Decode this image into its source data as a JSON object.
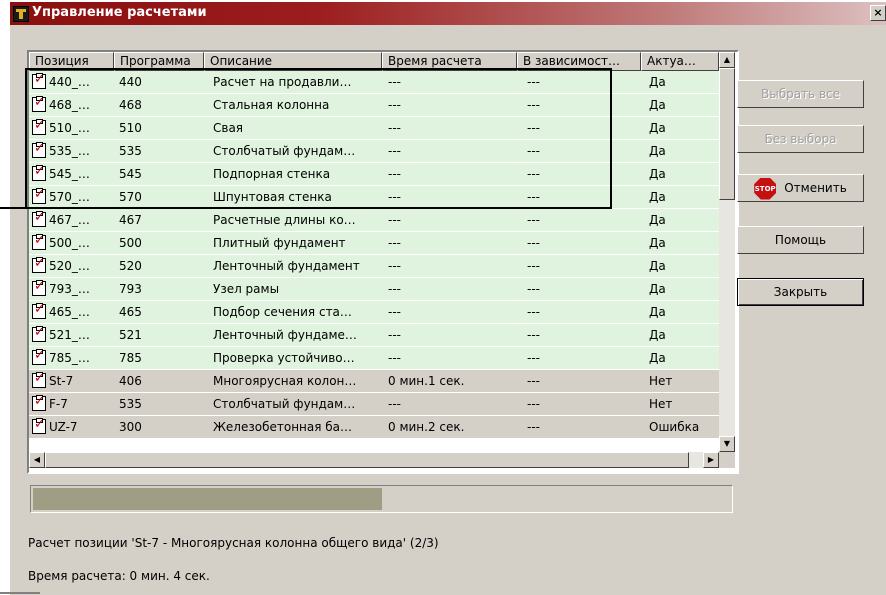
{
  "window": {
    "title": "Управление расчетами",
    "close_glyph": "×"
  },
  "columns": [
    "Позиция",
    "Программа",
    "Описание",
    "Время расчета",
    "В зависимост…",
    "Актуа…"
  ],
  "rows": [
    {
      "pos": "440_…",
      "prog": "440",
      "desc": "Расчет на продавли…",
      "time": "---",
      "dep": "---",
      "actual": "Да",
      "style": "green"
    },
    {
      "pos": "468_…",
      "prog": "468",
      "desc": "Стальная колонна",
      "time": "---",
      "dep": "---",
      "actual": "Да",
      "style": "green"
    },
    {
      "pos": "510_…",
      "prog": "510",
      "desc": "Свая",
      "time": "---",
      "dep": "---",
      "actual": "Да",
      "style": "green"
    },
    {
      "pos": "535_…",
      "prog": "535",
      "desc": "Столбчатый фундам…",
      "time": "---",
      "dep": "---",
      "actual": "Да",
      "style": "green"
    },
    {
      "pos": "545_…",
      "prog": "545",
      "desc": "Подпорная стенка",
      "time": "---",
      "dep": "---",
      "actual": "Да",
      "style": "green"
    },
    {
      "pos": "570_…",
      "prog": "570",
      "desc": "Шпунтовая стенка",
      "time": "---",
      "dep": "---",
      "actual": "Да",
      "style": "green"
    },
    {
      "pos": "467_…",
      "prog": "467",
      "desc": "Расчетные длины ко…",
      "time": "---",
      "dep": "---",
      "actual": "Да",
      "style": "green"
    },
    {
      "pos": "500_…",
      "prog": "500",
      "desc": "Плитный фундамент",
      "time": "---",
      "dep": "---",
      "actual": "Да",
      "style": "green"
    },
    {
      "pos": "520_…",
      "prog": "520",
      "desc": "Ленточный фундамент",
      "time": "---",
      "dep": "---",
      "actual": "Да",
      "style": "green"
    },
    {
      "pos": "793_…",
      "prog": "793",
      "desc": "Узел рамы",
      "time": "---",
      "dep": "---",
      "actual": "Да",
      "style": "green"
    },
    {
      "pos": "465_…",
      "prog": "465",
      "desc": "Подбор сечения ста…",
      "time": "---",
      "dep": "---",
      "actual": "Да",
      "style": "green"
    },
    {
      "pos": "521_…",
      "prog": "521",
      "desc": "Ленточный фундаме…",
      "time": "---",
      "dep": "---",
      "actual": "Да",
      "style": "green"
    },
    {
      "pos": "785_…",
      "prog": "785",
      "desc": "Проверка устойчиво…",
      "time": "---",
      "dep": "---",
      "actual": "Да",
      "style": "green"
    },
    {
      "pos": "St-7",
      "prog": "406",
      "desc": "Многоярусная колон…",
      "time": "0 мин.1 сек.",
      "dep": "---",
      "actual": "Нет",
      "style": "gray"
    },
    {
      "pos": "F-7",
      "prog": "535",
      "desc": "Столбчатый фундам…",
      "time": "---",
      "dep": "---",
      "actual": "Нет",
      "style": "gray"
    },
    {
      "pos": "UZ-7",
      "prog": "300",
      "desc": "Железобетонная ба…",
      "time": "0 мин.2 сек.",
      "dep": "---",
      "actual": "Ошибка",
      "style": "gray"
    }
  ],
  "buttons": {
    "select_all": "Выбрать все",
    "deselect": "Без выбора",
    "cancel": "Отменить",
    "cancel_icon_text": "STOP",
    "help": "Помощь",
    "close": "Закрыть"
  },
  "progress": {
    "fraction": 0.5
  },
  "status": {
    "line1": "Расчет позиции 'St-7 - Многоярусная колонна общего вида' (2/3)",
    "line2": "Время расчета: 0 мин. 4 сек."
  }
}
